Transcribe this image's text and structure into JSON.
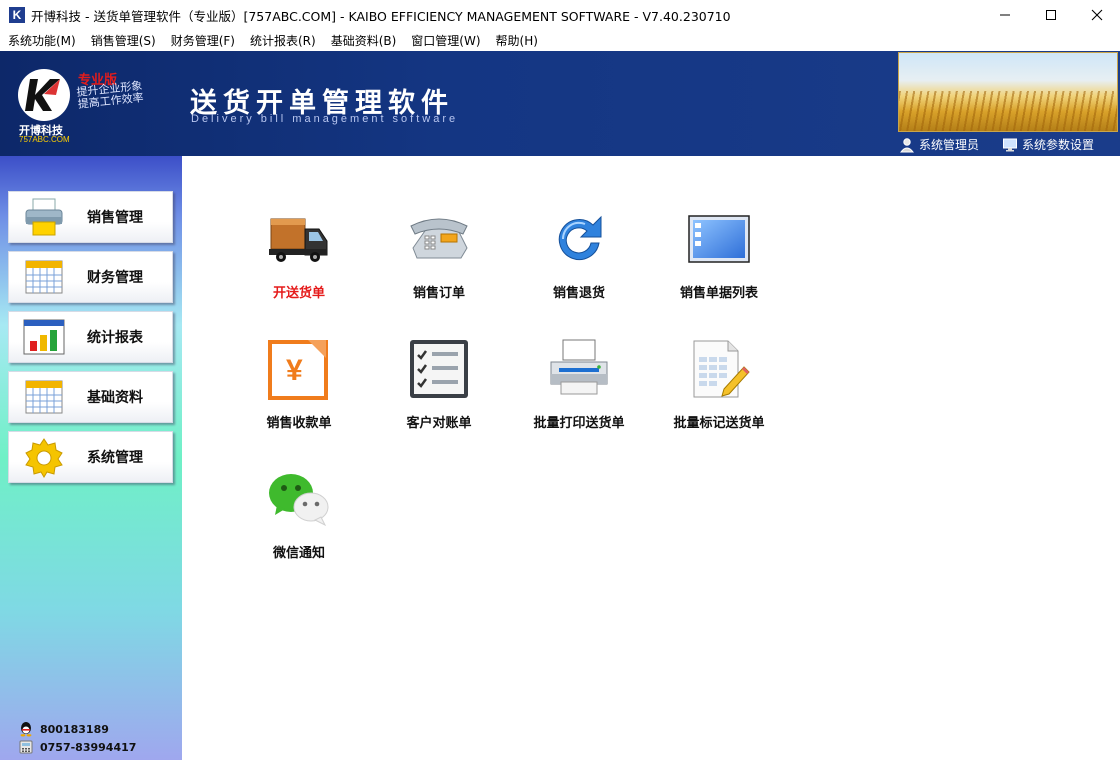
{
  "window": {
    "app_icon_letter": "K",
    "title": "开博科技 - 送货单管理软件（专业版）[757ABC.COM] - KAIBO EFFICIENCY MANAGEMENT SOFTWARE - V7.40.230710"
  },
  "menu": [
    {
      "label": "系统功能(M)"
    },
    {
      "label": "销售管理(S)"
    },
    {
      "label": "财务管理(F)"
    },
    {
      "label": "统计报表(R)"
    },
    {
      "label": "基础资料(B)"
    },
    {
      "label": "窗口管理(W)"
    },
    {
      "label": "帮助(H)"
    }
  ],
  "banner": {
    "edition": "专业版",
    "slogan_line1": "提升企业形象",
    "slogan_line2": "提高工作效率",
    "company": "开博科技",
    "url": "757ABC.COM",
    "title": "送货开单管理软件",
    "subtitle": "Delivery bill management software",
    "user_label": "系统管理员",
    "settings_label": "系统参数设置"
  },
  "sidebar": {
    "items": [
      {
        "label": "销售管理",
        "icon": "printer-icon"
      },
      {
        "label": "财务管理",
        "icon": "calendar-grid-icon"
      },
      {
        "label": "统计报表",
        "icon": "bar-chart-icon"
      },
      {
        "label": "基础资料",
        "icon": "calendar-grid-icon"
      },
      {
        "label": "系统管理",
        "icon": "gear-icon"
      }
    ],
    "contacts": [
      {
        "value": "800183189",
        "icon": "qq-icon"
      },
      {
        "value": "0757-83994417",
        "icon": "phone-icon"
      }
    ]
  },
  "functions": [
    {
      "label": "开送货单",
      "icon": "truck-icon",
      "active": true
    },
    {
      "label": "销售订单",
      "icon": "telephone-icon",
      "active": false
    },
    {
      "label": "销售退货",
      "icon": "refresh-arrow-icon",
      "active": false
    },
    {
      "label": "销售单据列表",
      "icon": "list-window-icon",
      "active": false
    },
    {
      "label": "销售收款单",
      "icon": "yen-receipt-icon",
      "active": false
    },
    {
      "label": "客户对账单",
      "icon": "checklist-icon",
      "active": false
    },
    {
      "label": "批量打印送货单",
      "icon": "printer-icon",
      "active": false
    },
    {
      "label": "批量标记送货单",
      "icon": "spreadsheet-pencil-icon",
      "active": false
    },
    {
      "label": "微信通知",
      "icon": "wechat-icon",
      "active": false
    }
  ],
  "colors": {
    "banner_bg": "#143683",
    "active_label": "#e51b1b",
    "edition_red": "#e21c1c"
  }
}
